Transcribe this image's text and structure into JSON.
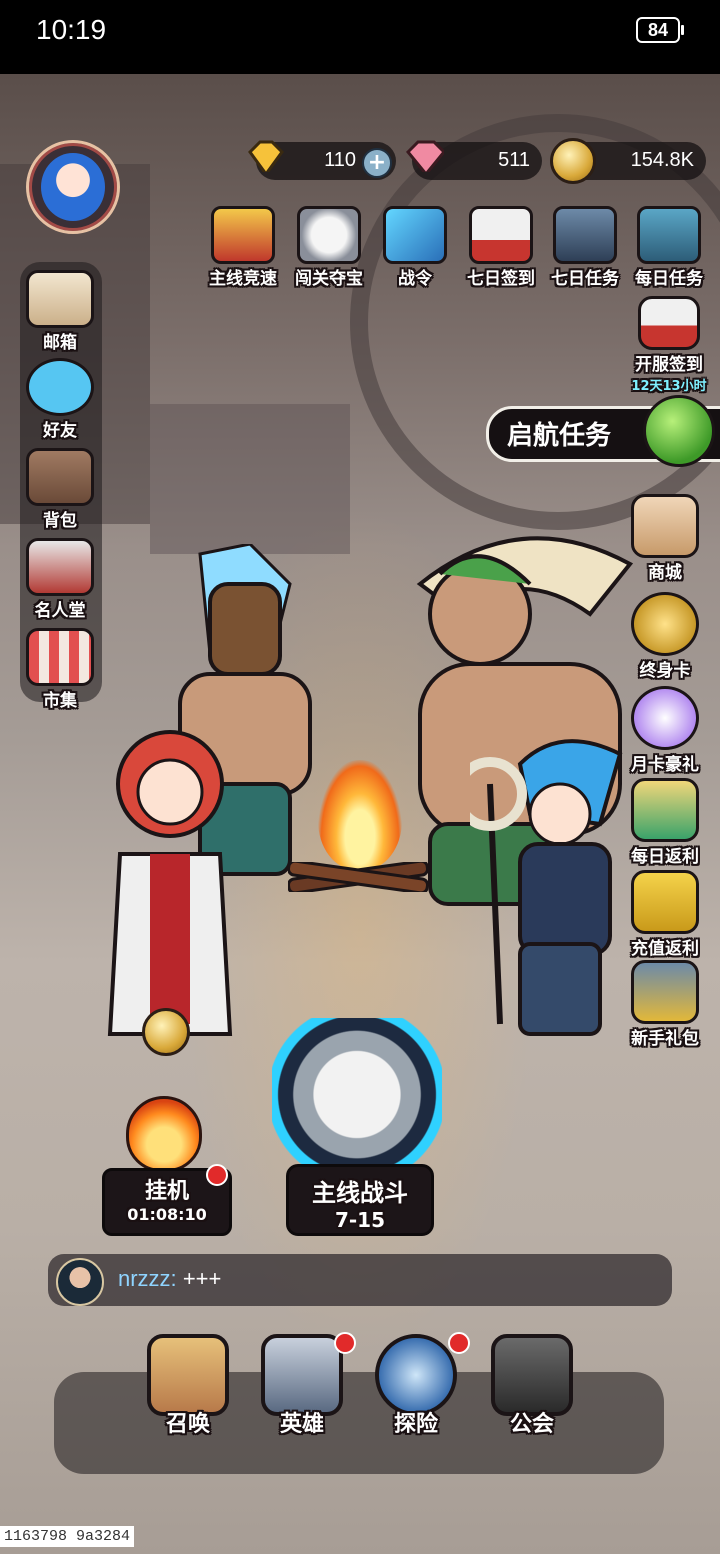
{
  "status_bar": {
    "time": "10:19",
    "battery": "84"
  },
  "currencies": [
    {
      "icon": "gold-gem-icon",
      "value": "110"
    },
    {
      "icon": "pink-gem-icon",
      "value": "511"
    },
    {
      "icon": "coin-icon",
      "value": "154.8K"
    }
  ],
  "top_menu": [
    {
      "label": "主线竞速",
      "icon": "trophy-icon"
    },
    {
      "label": "闯关夺宝",
      "icon": "wolf-mask-icon"
    },
    {
      "label": "战令",
      "icon": "scroll-icon"
    },
    {
      "label": "七日签到",
      "icon": "calendar-icon"
    },
    {
      "label": "七日任务",
      "icon": "helmet-icon"
    },
    {
      "label": "每日任务",
      "icon": "book-icon"
    }
  ],
  "server_signin": {
    "label": "开服签到",
    "timer": "12天13小时"
  },
  "quest_banner": {
    "label": "启航任务"
  },
  "left_menu": [
    {
      "label": "邮箱",
      "icon": "mail-icon"
    },
    {
      "label": "好友",
      "icon": "friends-icon"
    },
    {
      "label": "背包",
      "icon": "backpack-icon"
    },
    {
      "label": "名人堂",
      "icon": "hall-of-fame-icon"
    },
    {
      "label": "市集",
      "icon": "market-icon"
    }
  ],
  "right_menu": [
    {
      "label": "商城",
      "icon": "shop-bag-icon"
    },
    {
      "label": "终身卡",
      "icon": "crown-icon"
    },
    {
      "label": "月卡豪礼",
      "icon": "ssr-card-icon"
    },
    {
      "label": "每日返利",
      "icon": "gift-box-icon"
    },
    {
      "label": "充值返利",
      "icon": "match-card-icon"
    },
    {
      "label": "新手礼包",
      "icon": "starter-pack-icon"
    }
  ],
  "idle": {
    "label": "挂机",
    "timer": "01:08:10"
  },
  "main_battle": {
    "label": "主线战斗",
    "stage": "7-15"
  },
  "chat": {
    "user": "nrzzz:",
    "message": "+++"
  },
  "bottom_nav": [
    {
      "label": "召唤",
      "icon": "summon-icon"
    },
    {
      "label": "英雄",
      "icon": "hero-icon"
    },
    {
      "label": "探险",
      "icon": "compass-icon"
    },
    {
      "label": "公会",
      "icon": "guild-shield-icon"
    }
  ],
  "build_id": "1163798 9a3284",
  "colors": {
    "accent_cyan": "#2fd1ff",
    "badge_red": "#e12a2a",
    "timer_cyan": "#7ff0ff"
  }
}
